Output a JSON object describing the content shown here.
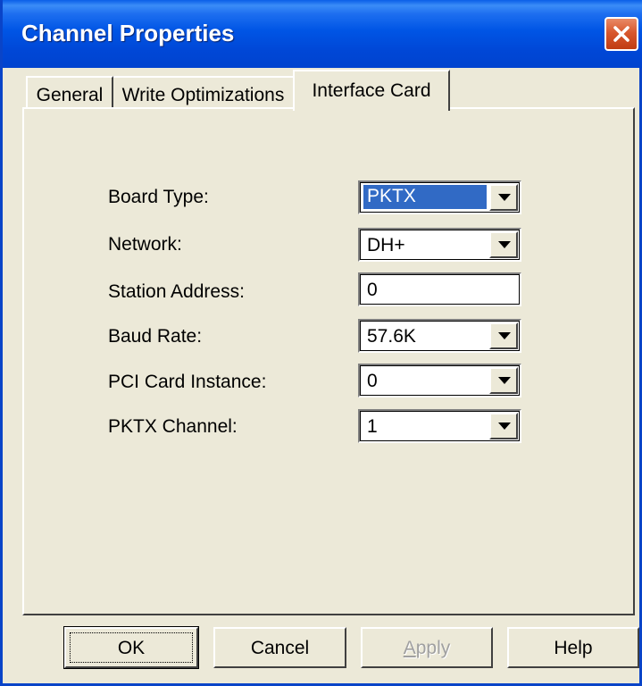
{
  "window": {
    "title": "Channel Properties",
    "close_icon": "close-x-icon"
  },
  "tabs": [
    {
      "label": "General",
      "active": false
    },
    {
      "label": "Write Optimizations",
      "active": false
    },
    {
      "label": "Interface Card",
      "active": true
    }
  ],
  "fields": {
    "board_type": {
      "label": "Board Type:",
      "value": "PKTX",
      "selected": true
    },
    "network": {
      "label": "Network:",
      "value": "DH+"
    },
    "station_address": {
      "label": "Station Address:",
      "value": "0"
    },
    "baud_rate": {
      "label": "Baud Rate:",
      "value": "57.6K"
    },
    "pci_card_instance": {
      "label": "PCI Card Instance:",
      "value": "0"
    },
    "pktx_channel": {
      "label": "PKTX Channel:",
      "value": "1"
    }
  },
  "buttons": {
    "ok": "OK",
    "cancel": "Cancel",
    "apply": "Apply",
    "help": "Help"
  },
  "colors": {
    "title_bar": "#0055e5",
    "face": "#ece9d8",
    "selection": "#316ac5",
    "close_button": "#d8582e"
  }
}
